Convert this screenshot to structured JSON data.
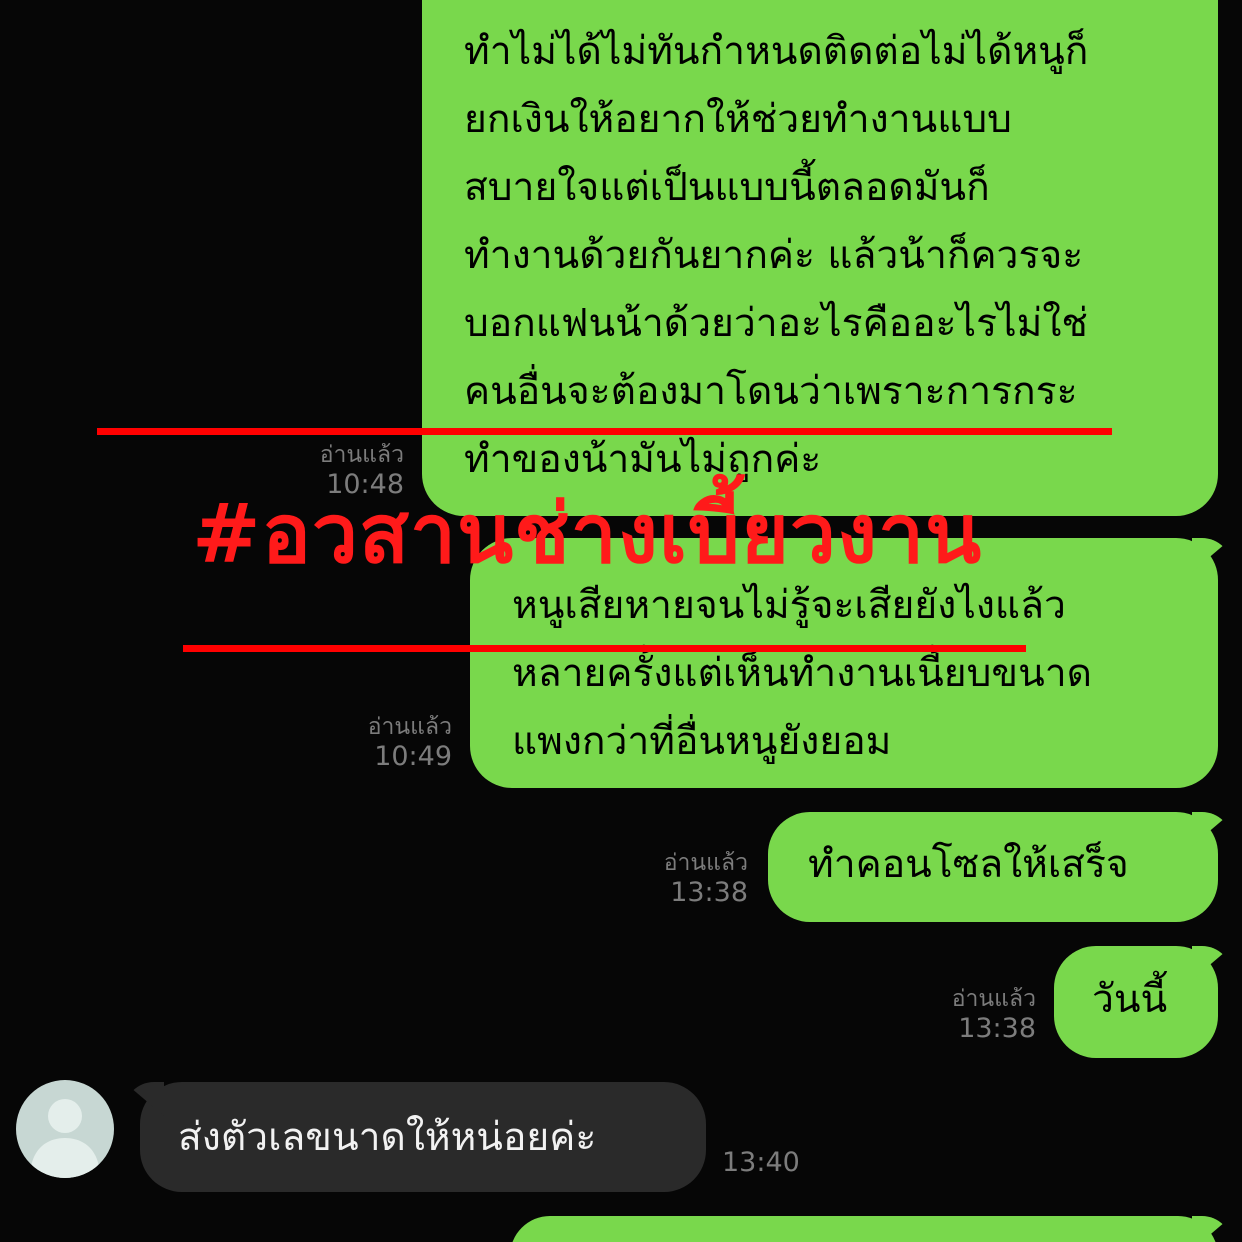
{
  "messages": [
    {
      "direction": "outgoing",
      "text": "ทำไม่ได้ไม่ทันกำหนดติดต่อไม่ได้หนูก็\nยกเงินให้อยากให้ช่วยทำงานแบบ\nสบายใจแต่เป็นแบบนี้ตลอดมันก็\nทำงานด้วยกันยากค่ะ แล้วน้าก็ควรจะ\nบอกแฟนน้าด้วยว่าอะไรคืออะไรไม่ใช่\nคนอื่นจะต้องมาโดนว่าเพราะการกระ\nทำของน้ามันไม่ถูกค่ะ",
      "read": "อ่านแล้ว",
      "time": "10:48"
    },
    {
      "direction": "outgoing",
      "text": "หนูเสียหายจนไม่รู้จะเสียยังไงแล้ว\nหลายครั้งแต่เห็นทำงานเนี้ยบขนาด\nแพงกว่าที่อื่นหนูยังยอม",
      "read": "อ่านแล้ว",
      "time": "10:49"
    },
    {
      "direction": "outgoing",
      "text": "ทำคอนโซลให้เสร็จ",
      "read": "อ่านแล้ว",
      "time": "13:38"
    },
    {
      "direction": "outgoing",
      "text": "วันนี้",
      "read": "อ่านแล้ว",
      "time": "13:38"
    },
    {
      "direction": "incoming",
      "text": "ส่งตัวเลขนาดให้หน่อยค่ะ",
      "time": "13:40"
    }
  ],
  "overlay": {
    "hashtag": "#อวสานช่างเบี้ยวงาน",
    "color": "#ff0000"
  },
  "colors": {
    "outgoing_bubble": "#79d84c",
    "incoming_bubble": "#2a2a2a",
    "background": "#060606"
  },
  "icons": {
    "avatar": "default-user-avatar-icon"
  }
}
